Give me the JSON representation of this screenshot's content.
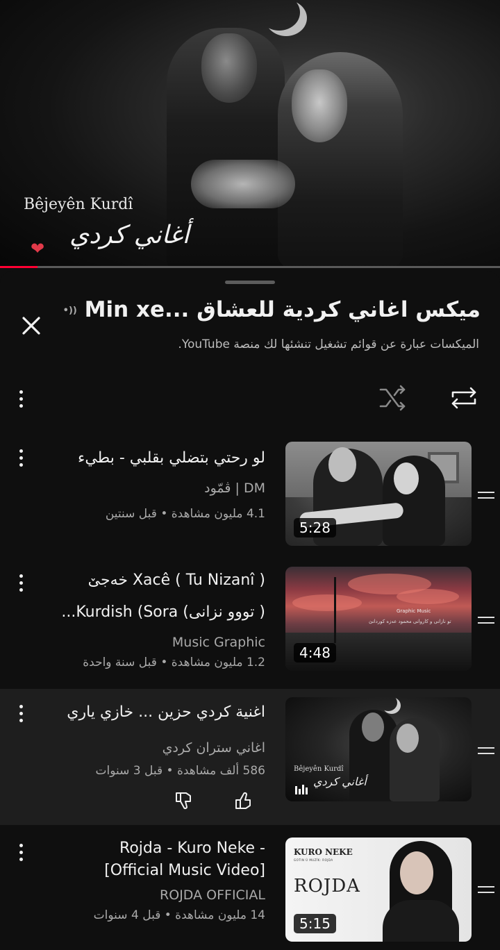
{
  "player": {
    "brand_text": "Bêjeyên Kurdî",
    "logo_text": "أغاني كردي",
    "progress": 0.075,
    "accent_color": "#ff0033"
  },
  "queue": {
    "title": "ميكس اغاني كردية للعشاق ...Min xe",
    "subtitle": "الميكسات عبارة عن قوائم تشغيل تنشئها لك منصة YouTube.",
    "live_icon": "broadcast-icon",
    "controls": {
      "close_icon": "close-icon",
      "shuffle_icon": "shuffle-icon",
      "repeat_icon": "repeat-icon",
      "menu_icon": "more-vert-icon"
    }
  },
  "videos": [
    {
      "title_line1": "لو رحتي بتضلي بقلبي - بطيء",
      "title_line2": "",
      "channel": "DM | ڤمّود",
      "meta": "4.1 مليون مشاهدة • قبل سنتين",
      "duration": "5:28"
    },
    {
      "title_line1": "Xacê ( Tu Nizanî ) خەجێ",
      "title_line2": "( تووو نزانی) Kurdish (Sora...",
      "channel": "Music Graphic",
      "meta": "1.2 مليون مشاهدة • قبل سنة واحدة",
      "duration": "4:48",
      "thumb_text_1": "Graphic Music",
      "thumb_text_2": "تو نازانی و کاروانی محمود عەزە کوردانێ"
    },
    {
      "title_line1": "اغنية كردي حزين ... خازي ياري",
      "title_line2": "",
      "channel": "اغاني ستران كردي",
      "meta": "586 ألف مشاهدة • قبل 3 سنوات",
      "duration": "",
      "now_playing": true,
      "thumb_brand": "Bêjeyên Kurdî",
      "thumb_logo": "أغاني كردي"
    },
    {
      "title_line1": "Rojda - Kuro Neke -",
      "title_line2": "[Official Music Video]",
      "channel": "ROJDA OFFICIAL",
      "meta": "14 مليون مشاهدة • قبل 4 سنوات",
      "duration": "5:15",
      "thumb_header": "KURO NEKE",
      "thumb_credit": "GOTIN Û MUZÎK: ROJDA",
      "thumb_artist": "ROJDA"
    }
  ]
}
